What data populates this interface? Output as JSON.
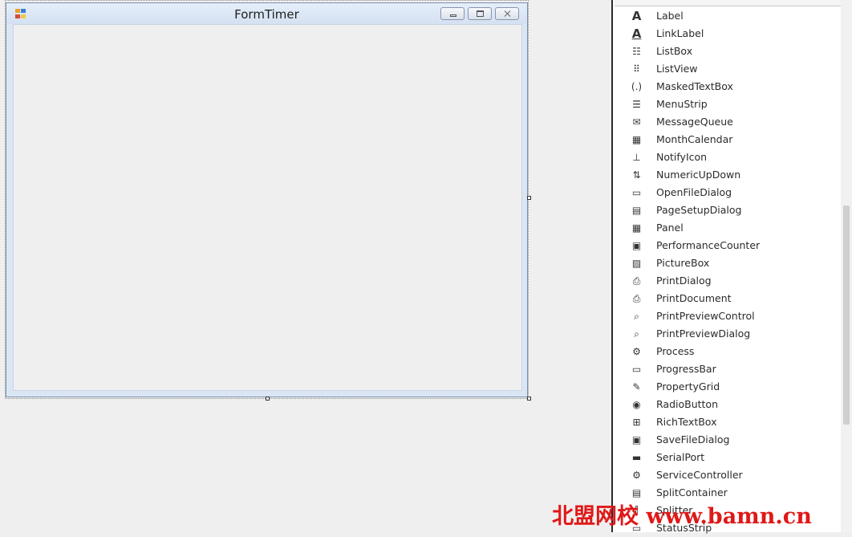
{
  "form": {
    "title": "FormTimer"
  },
  "toolbox": {
    "items": [
      {
        "label": "Label",
        "icon": "label-icon"
      },
      {
        "label": "LinkLabel",
        "icon": "link-label-icon"
      },
      {
        "label": "ListBox",
        "icon": "list-box-icon"
      },
      {
        "label": "ListView",
        "icon": "list-view-icon"
      },
      {
        "label": "MaskedTextBox",
        "icon": "masked-textbox-icon"
      },
      {
        "label": "MenuStrip",
        "icon": "menu-strip-icon"
      },
      {
        "label": "MessageQueue",
        "icon": "message-queue-icon"
      },
      {
        "label": "MonthCalendar",
        "icon": "month-calendar-icon"
      },
      {
        "label": "NotifyIcon",
        "icon": "notify-icon-icon"
      },
      {
        "label": "NumericUpDown",
        "icon": "numeric-updown-icon"
      },
      {
        "label": "OpenFileDialog",
        "icon": "open-file-dialog-icon"
      },
      {
        "label": "PageSetupDialog",
        "icon": "page-setup-dialog-icon"
      },
      {
        "label": "Panel",
        "icon": "panel-icon"
      },
      {
        "label": "PerformanceCounter",
        "icon": "performance-counter-icon"
      },
      {
        "label": "PictureBox",
        "icon": "picture-box-icon"
      },
      {
        "label": "PrintDialog",
        "icon": "print-dialog-icon"
      },
      {
        "label": "PrintDocument",
        "icon": "print-document-icon"
      },
      {
        "label": "PrintPreviewControl",
        "icon": "print-preview-control-icon"
      },
      {
        "label": "PrintPreviewDialog",
        "icon": "print-preview-dialog-icon"
      },
      {
        "label": "Process",
        "icon": "process-icon"
      },
      {
        "label": "ProgressBar",
        "icon": "progress-bar-icon"
      },
      {
        "label": "PropertyGrid",
        "icon": "property-grid-icon"
      },
      {
        "label": "RadioButton",
        "icon": "radio-button-icon"
      },
      {
        "label": "RichTextBox",
        "icon": "rich-textbox-icon"
      },
      {
        "label": "SaveFileDialog",
        "icon": "save-file-dialog-icon"
      },
      {
        "label": "SerialPort",
        "icon": "serial-port-icon"
      },
      {
        "label": "ServiceController",
        "icon": "service-controller-icon"
      },
      {
        "label": "SplitContainer",
        "icon": "split-container-icon"
      },
      {
        "label": "Splitter",
        "icon": "splitter-icon"
      },
      {
        "label": "StatusStrip",
        "icon": "status-strip-icon"
      }
    ]
  },
  "watermark": {
    "text": "北盟网校 www.bamn.cn"
  },
  "colors": {
    "designer_bg": "#efefef",
    "form_border": "#7d8fa8",
    "toolbox_bg": "#ffffff",
    "watermark": "#e01818"
  }
}
